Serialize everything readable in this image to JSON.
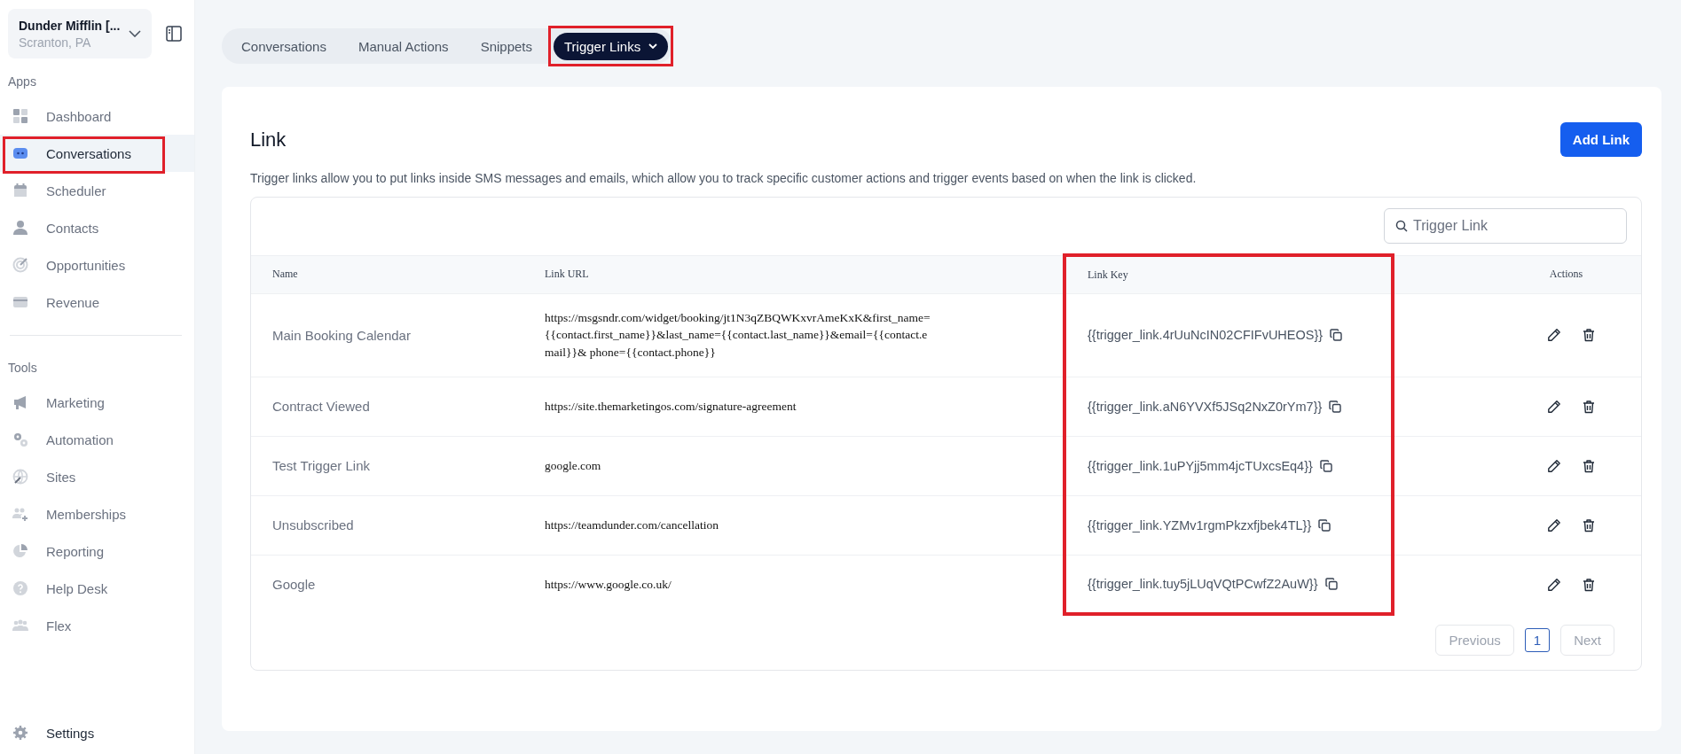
{
  "org": {
    "name": "Dunder Mifflin [...",
    "location": "Scranton, PA"
  },
  "sidebar": {
    "sections": [
      {
        "label": "Apps",
        "items": [
          {
            "label": "Dashboard",
            "selected": false,
            "highlighted": false
          },
          {
            "label": "Conversations",
            "selected": true,
            "highlighted": true
          },
          {
            "label": "Scheduler",
            "selected": false,
            "highlighted": false
          },
          {
            "label": "Contacts",
            "selected": false,
            "highlighted": false
          },
          {
            "label": "Opportunities",
            "selected": false,
            "highlighted": false
          },
          {
            "label": "Revenue",
            "selected": false,
            "highlighted": false
          }
        ]
      },
      {
        "label": "Tools",
        "items": [
          {
            "label": "Marketing",
            "selected": false,
            "highlighted": false
          },
          {
            "label": "Automation",
            "selected": false,
            "highlighted": false
          },
          {
            "label": "Sites",
            "selected": false,
            "highlighted": false
          },
          {
            "label": "Memberships",
            "selected": false,
            "highlighted": false
          },
          {
            "label": "Reporting",
            "selected": false,
            "highlighted": false
          },
          {
            "label": "Help Desk",
            "selected": false,
            "highlighted": false
          },
          {
            "label": "Flex",
            "selected": false,
            "highlighted": false
          }
        ]
      }
    ],
    "footer": {
      "label": "Settings"
    }
  },
  "tabs": [
    {
      "label": "Conversations",
      "selected": false,
      "has_menu": false,
      "highlighted": false
    },
    {
      "label": "Manual Actions",
      "selected": false,
      "has_menu": false,
      "highlighted": false
    },
    {
      "label": "Snippets",
      "selected": false,
      "has_menu": false,
      "highlighted": false
    },
    {
      "label": "Trigger Links",
      "selected": true,
      "has_menu": true,
      "highlighted": true
    }
  ],
  "card": {
    "title": "Link",
    "add_button": "Add Link",
    "description": "Trigger links allow you to put links inside SMS messages and emails, which allow you to track specific customer actions and trigger events based on when the link is clicked.",
    "search": {
      "placeholder": "Trigger Link"
    },
    "table": {
      "columns": [
        {
          "label": "Name",
          "highlighted": false
        },
        {
          "label": "Link URL",
          "highlighted": false
        },
        {
          "label": "Link Key",
          "highlighted": true
        },
        {
          "label": "Actions",
          "highlighted": false
        }
      ],
      "rows": [
        {
          "name": "Main Booking Calendar",
          "url": "https://msgsndr.com/widget/booking/jt1N3qZBQWKxvrAmeKxK&first_name={{contact.first_name}}&last_name={{contact.last_name}}&email={{contact.email}}& phone={{contact.phone}}",
          "key": "{{trigger_link.4rUuNcIN02CFIFvUHEOS}}"
        },
        {
          "name": "Contract Viewed",
          "url": "https://site.themarketingos.com/signature-agreement",
          "key": "{{trigger_link.aN6YVXf5JSq2NxZ0rYm7}}"
        },
        {
          "name": "Test Trigger Link",
          "url": "google.com",
          "key": "{{trigger_link.1uPYjj5mm4jcTUxcsEq4}}"
        },
        {
          "name": "Unsubscribed",
          "url": "https://teamdunder.com/cancellation",
          "key": "{{trigger_link.YZMv1rgmPkzxfjbek4TL}}"
        },
        {
          "name": "Google",
          "url": "https://www.google.co.uk/",
          "key": "{{trigger_link.tuy5jLUqVQtPCwfZ2AuW}}"
        }
      ]
    },
    "pagination": {
      "previous": {
        "label": "Previous",
        "disabled": true
      },
      "pages": [
        {
          "label": "1",
          "selected": true
        }
      ],
      "next": {
        "label": "Next",
        "disabled": true
      }
    }
  }
}
